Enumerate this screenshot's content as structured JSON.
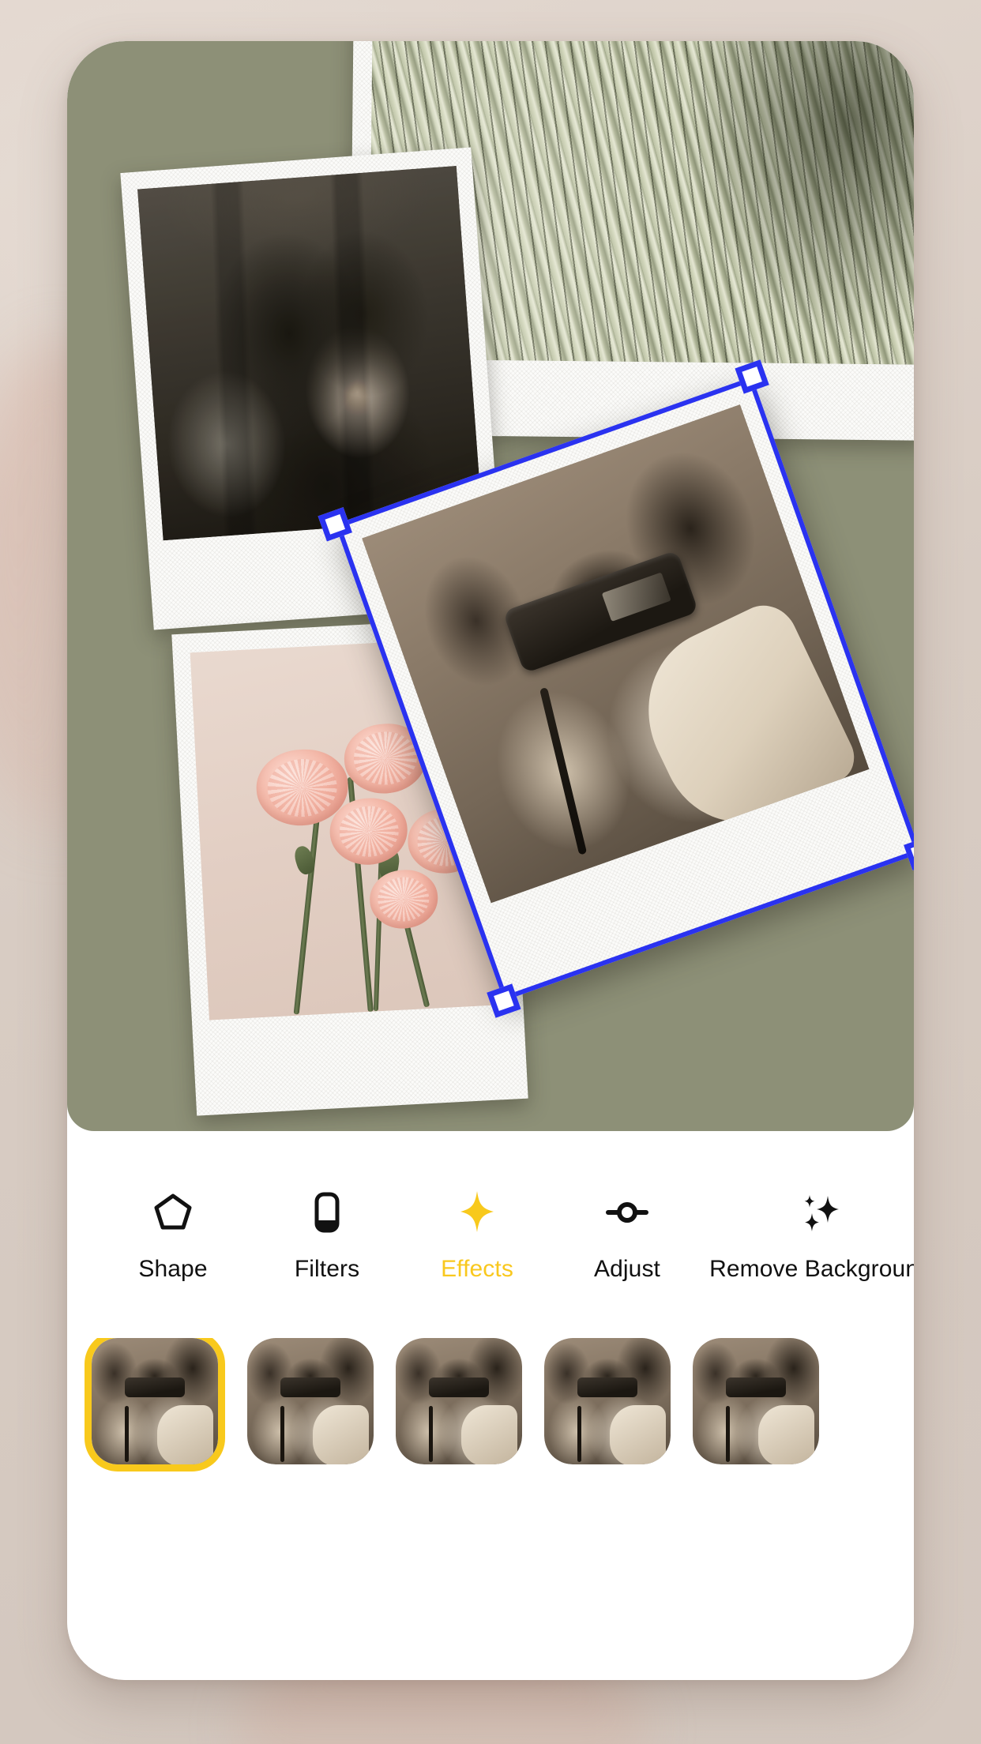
{
  "app": {
    "accent_yellow": "#F8C91C",
    "selection_blue": "#2A32F0",
    "canvas_background": "#8D9077",
    "sheet_background": "#FFFFFF",
    "desk_background": "#D9CEC6"
  },
  "canvas": {
    "name": "collage-canvas",
    "layers": [
      {
        "id": "palm",
        "name": "palm-frond-polaroid",
        "selected": false
      },
      {
        "id": "couple",
        "name": "couple-kissing-polaroid",
        "selected": false
      },
      {
        "id": "flowers",
        "name": "pink-carnations-polaroid",
        "selected": false
      },
      {
        "id": "camera",
        "name": "woman-with-camera-polaroid",
        "selected": true
      }
    ],
    "selection": {
      "active_layer": "camera",
      "handles": [
        "top-left",
        "top-right",
        "bottom-left",
        "bottom-right"
      ]
    }
  },
  "toolbar": {
    "name": "editor-toolbar",
    "active": "Effects",
    "items": [
      {
        "label": "Shape",
        "icon": "pentagon-icon",
        "active": false
      },
      {
        "label": "Filters",
        "icon": "filters-square-icon",
        "active": false
      },
      {
        "label": "Effects",
        "icon": "sparkle-four-point-icon",
        "active": true
      },
      {
        "label": "Adjust",
        "icon": "slider-knob-icon",
        "active": false
      },
      {
        "label": "Remove Background",
        "icon": "sparkles-icon",
        "active": false
      }
    ]
  },
  "effects_strip": {
    "name": "effect-presets",
    "selected_index": 0,
    "thumbnails": [
      {
        "selected": true
      },
      {
        "selected": false
      },
      {
        "selected": false
      },
      {
        "selected": false
      },
      {
        "selected": false
      }
    ]
  }
}
